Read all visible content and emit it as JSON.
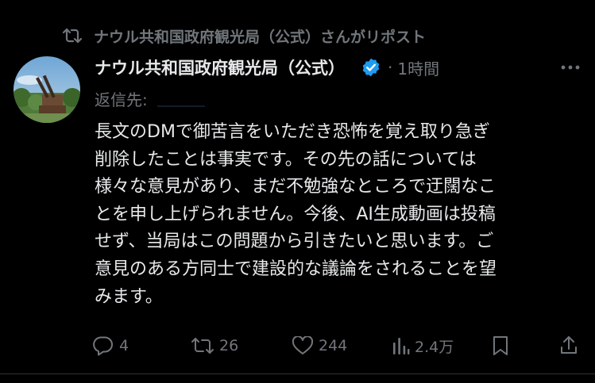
{
  "repost_header": {
    "text": "ナウル共和国政府観光局（公式）さんがリポスト",
    "icon": "repost-icon"
  },
  "post": {
    "author": {
      "display_name": "ナウル共和国政府観光局（公式）",
      "verified": true,
      "avatar": "avatar-photo"
    },
    "separator": "·",
    "timestamp": "1時間",
    "reply_label": "返信先:",
    "body_lines": [
      "長文のDMで御苦言をいただき恐怖を覚え取り急ぎ",
      "削除したことは事実です。その先の話については",
      "様々な意見があり、まだ不勉強なところで迂闊なこ",
      "とを申し上げられません。今後、AI生成動画は投稿",
      "せず、当局はこの問題から引きたいと思います。ご",
      "意見のある方同士で建設的な議論をされることを望",
      "みます。"
    ]
  },
  "actions": {
    "reply": {
      "icon": "reply-icon",
      "count": "4"
    },
    "repost": {
      "icon": "repost-icon",
      "count": "26"
    },
    "like": {
      "icon": "heart-icon",
      "count": "244"
    },
    "views": {
      "icon": "views-icon",
      "count": "2.4万"
    },
    "bookmark": {
      "icon": "bookmark-icon"
    },
    "share": {
      "icon": "share-icon"
    }
  },
  "colors": {
    "background": "#000000",
    "primary_text": "#e7e9ea",
    "secondary_text": "#71767b",
    "verified_badge": "#1d9bf0",
    "divider": "#2f3336"
  }
}
